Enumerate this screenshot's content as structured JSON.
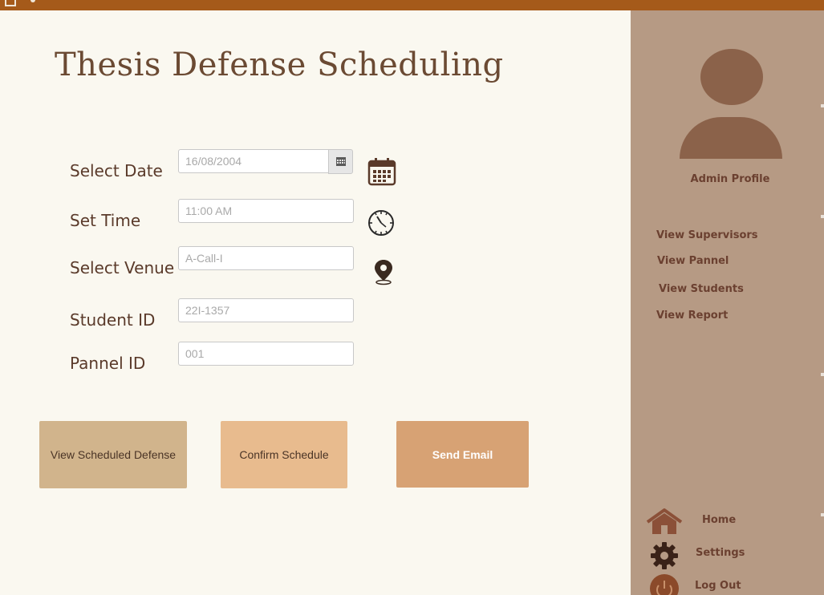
{
  "page": {
    "title": "Thesis Defense Scheduling"
  },
  "form": {
    "date": {
      "label": "Select Date",
      "value": "16/08/2004"
    },
    "time": {
      "label": "Set Time",
      "value": "11:00 AM"
    },
    "venue": {
      "label": "Select Venue",
      "value": "A-Call-I"
    },
    "student": {
      "label": "Student ID",
      "value": "22I-1357"
    },
    "panel": {
      "label": "Pannel ID",
      "value": "001"
    }
  },
  "actions": {
    "view_scheduled": "View Scheduled Defense",
    "confirm": "Confirm Schedule",
    "send_email": "Send Email"
  },
  "sidebar": {
    "profile_label": "Admin Profile",
    "links": [
      "View Supervisors",
      "View Pannel",
      "View Students",
      "View Report"
    ],
    "bottom": {
      "home": "Home",
      "settings": "Settings",
      "logout": "Log Out"
    }
  },
  "icons": {
    "date_picker": "calendar-grid-icon",
    "date": "calendar-icon",
    "time": "clock-icon",
    "venue": "location-pin-icon",
    "home": "home-icon",
    "settings": "gear-icon",
    "logout": "power-icon"
  },
  "colors": {
    "titlebar": "#a55a1a",
    "background": "#faf8f0",
    "sidebar": "#b69a84",
    "avatar": "#8b624a",
    "text_brown": "#6b4030",
    "btn_view": "#d1b48c",
    "btn_confirm": "#e8bb8e",
    "btn_email": "#d7a274"
  }
}
